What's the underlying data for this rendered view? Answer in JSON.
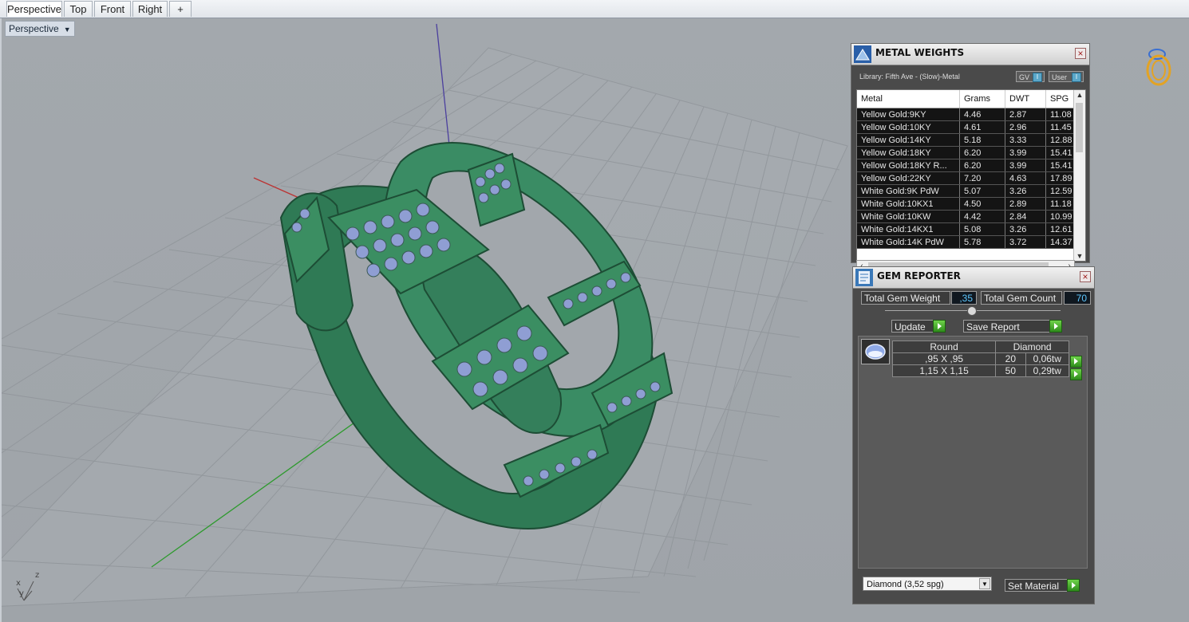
{
  "tabs": [
    "Perspective",
    "Top",
    "Front",
    "Right",
    "+"
  ],
  "viewport": {
    "title": "Perspective"
  },
  "axes": {
    "z": "z",
    "x": "x",
    "y": "y"
  },
  "metal_weights": {
    "title": "METAL WEIGHTS",
    "library": "Library: Fifth Ave - (Slow)-Metal",
    "toggle_gv": "GV",
    "toggle_user": "User",
    "columns": [
      "Metal",
      "Grams",
      "DWT",
      "SPG"
    ],
    "rows": [
      [
        "Yellow Gold:9KY",
        "4.46",
        "2.87",
        "11.08"
      ],
      [
        "Yellow Gold:10KY",
        "4.61",
        "2.96",
        "11.45"
      ],
      [
        "Yellow Gold:14KY",
        "5.18",
        "3.33",
        "12.88"
      ],
      [
        "Yellow Gold:18KY",
        "6.20",
        "3.99",
        "15.41"
      ],
      [
        "Yellow Gold:18KY R...",
        "6.20",
        "3.99",
        "15.41"
      ],
      [
        "Yellow Gold:22KY",
        "7.20",
        "4.63",
        "17.89"
      ],
      [
        "White Gold:9K PdW",
        "5.07",
        "3.26",
        "12.59"
      ],
      [
        "White Gold:10KX1",
        "4.50",
        "2.89",
        "11.18"
      ],
      [
        "White Gold:10KW",
        "4.42",
        "2.84",
        "10.99"
      ],
      [
        "White Gold:14KX1",
        "5.08",
        "3.26",
        "12.61"
      ],
      [
        "White Gold:14K PdW",
        "5.78",
        "3.72",
        "14.37"
      ]
    ]
  },
  "gem_reporter": {
    "title": "GEM REPORTER",
    "total_weight_label": "Total Gem Weight",
    "total_weight_value": ",35",
    "total_count_label": "Total Gem Count",
    "total_count_value": "70",
    "update_label": "Update",
    "save_report_label": "Save Report",
    "shape": "Round",
    "material": "Diamond",
    "gems": [
      {
        "size": ",95 X ,95",
        "count": "20",
        "weight": "0,06tw"
      },
      {
        "size": "1,15 X 1,15",
        "count": "50",
        "weight": "0,29tw"
      }
    ],
    "material_select": "Diamond     (3,52 spg)",
    "set_material_label": "Set Material"
  }
}
